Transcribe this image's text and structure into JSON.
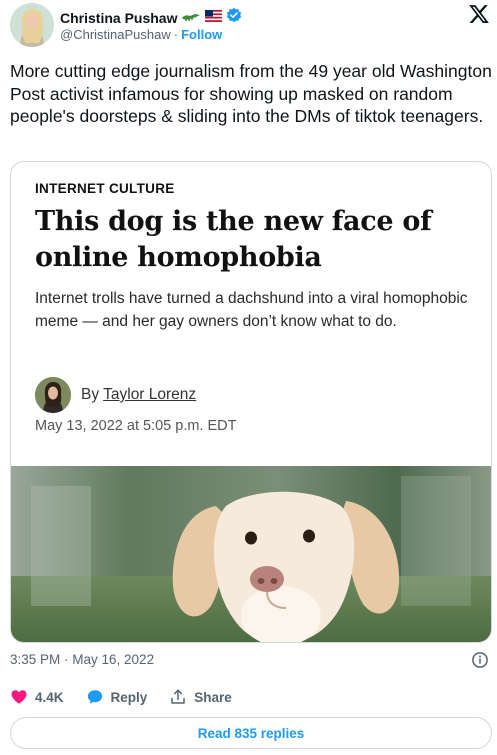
{
  "author": {
    "name": "Christina Pushaw",
    "handle": "@ChristinaPushaw",
    "separator": "·",
    "follow_label": "Follow",
    "name_emojis": [
      "alligator-icon",
      "us-flag-icon",
      "verified-badge-icon"
    ]
  },
  "tweet": {
    "text": "More cutting edge journalism from the 49 year old Washington Post activist infamous for showing up masked on random people's doorsteps & sliding into the DMs of tiktok teenagers."
  },
  "card": {
    "kicker": "INTERNET CULTURE",
    "headline": "This dog is the new face of online homophobia",
    "dek": "Internet trolls have turned a dachshund into a viral homophobic meme — and her gay owners don’t know what to do.",
    "byline_prefix": "By",
    "author": "Taylor Lorenz",
    "date": "May 13, 2022 at 5:05 p.m. EDT"
  },
  "meta": {
    "timestamp": "3:35 PM · May 16, 2022"
  },
  "actions": {
    "like_count": "4.4K",
    "reply_label": "Reply",
    "share_label": "Share"
  },
  "read_replies_label": "Read 835 replies",
  "colors": {
    "accent": "#1d9bf0",
    "like": "#f91880",
    "text": "#0f1419",
    "muted": "#536471",
    "border": "#cfd9de"
  }
}
